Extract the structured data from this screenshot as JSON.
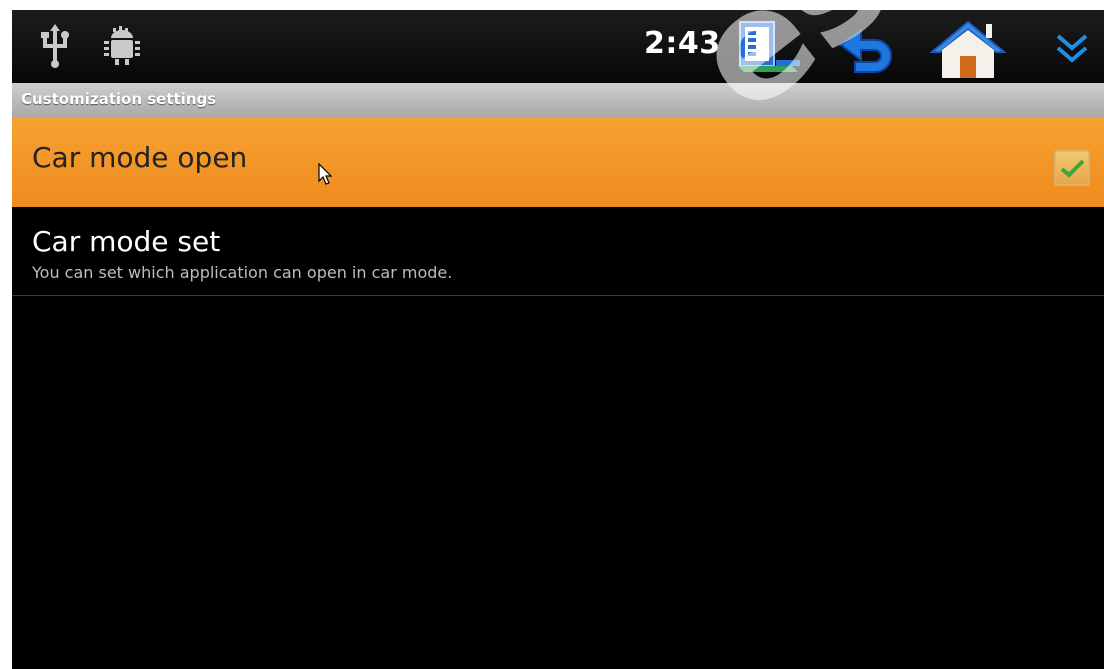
{
  "status_bar": {
    "time": "2:43",
    "icons": [
      "usb-icon",
      "android-debug-icon",
      "recent-apps-icon",
      "back-icon",
      "home-icon",
      "expand-down-icon"
    ]
  },
  "header": {
    "title": "Customization settings"
  },
  "settings": [
    {
      "title": "Car mode open",
      "checked": true,
      "highlighted": true
    },
    {
      "title": "Car mode set",
      "summary": "You can set which application can open in car mode."
    }
  ],
  "watermark": "es.",
  "colors": {
    "highlight": "#f39a2a",
    "header_bar": "#b9b9b9",
    "background": "#000000",
    "checkmark": "#3aaa35",
    "icon_blue": "#1f6fd6"
  }
}
